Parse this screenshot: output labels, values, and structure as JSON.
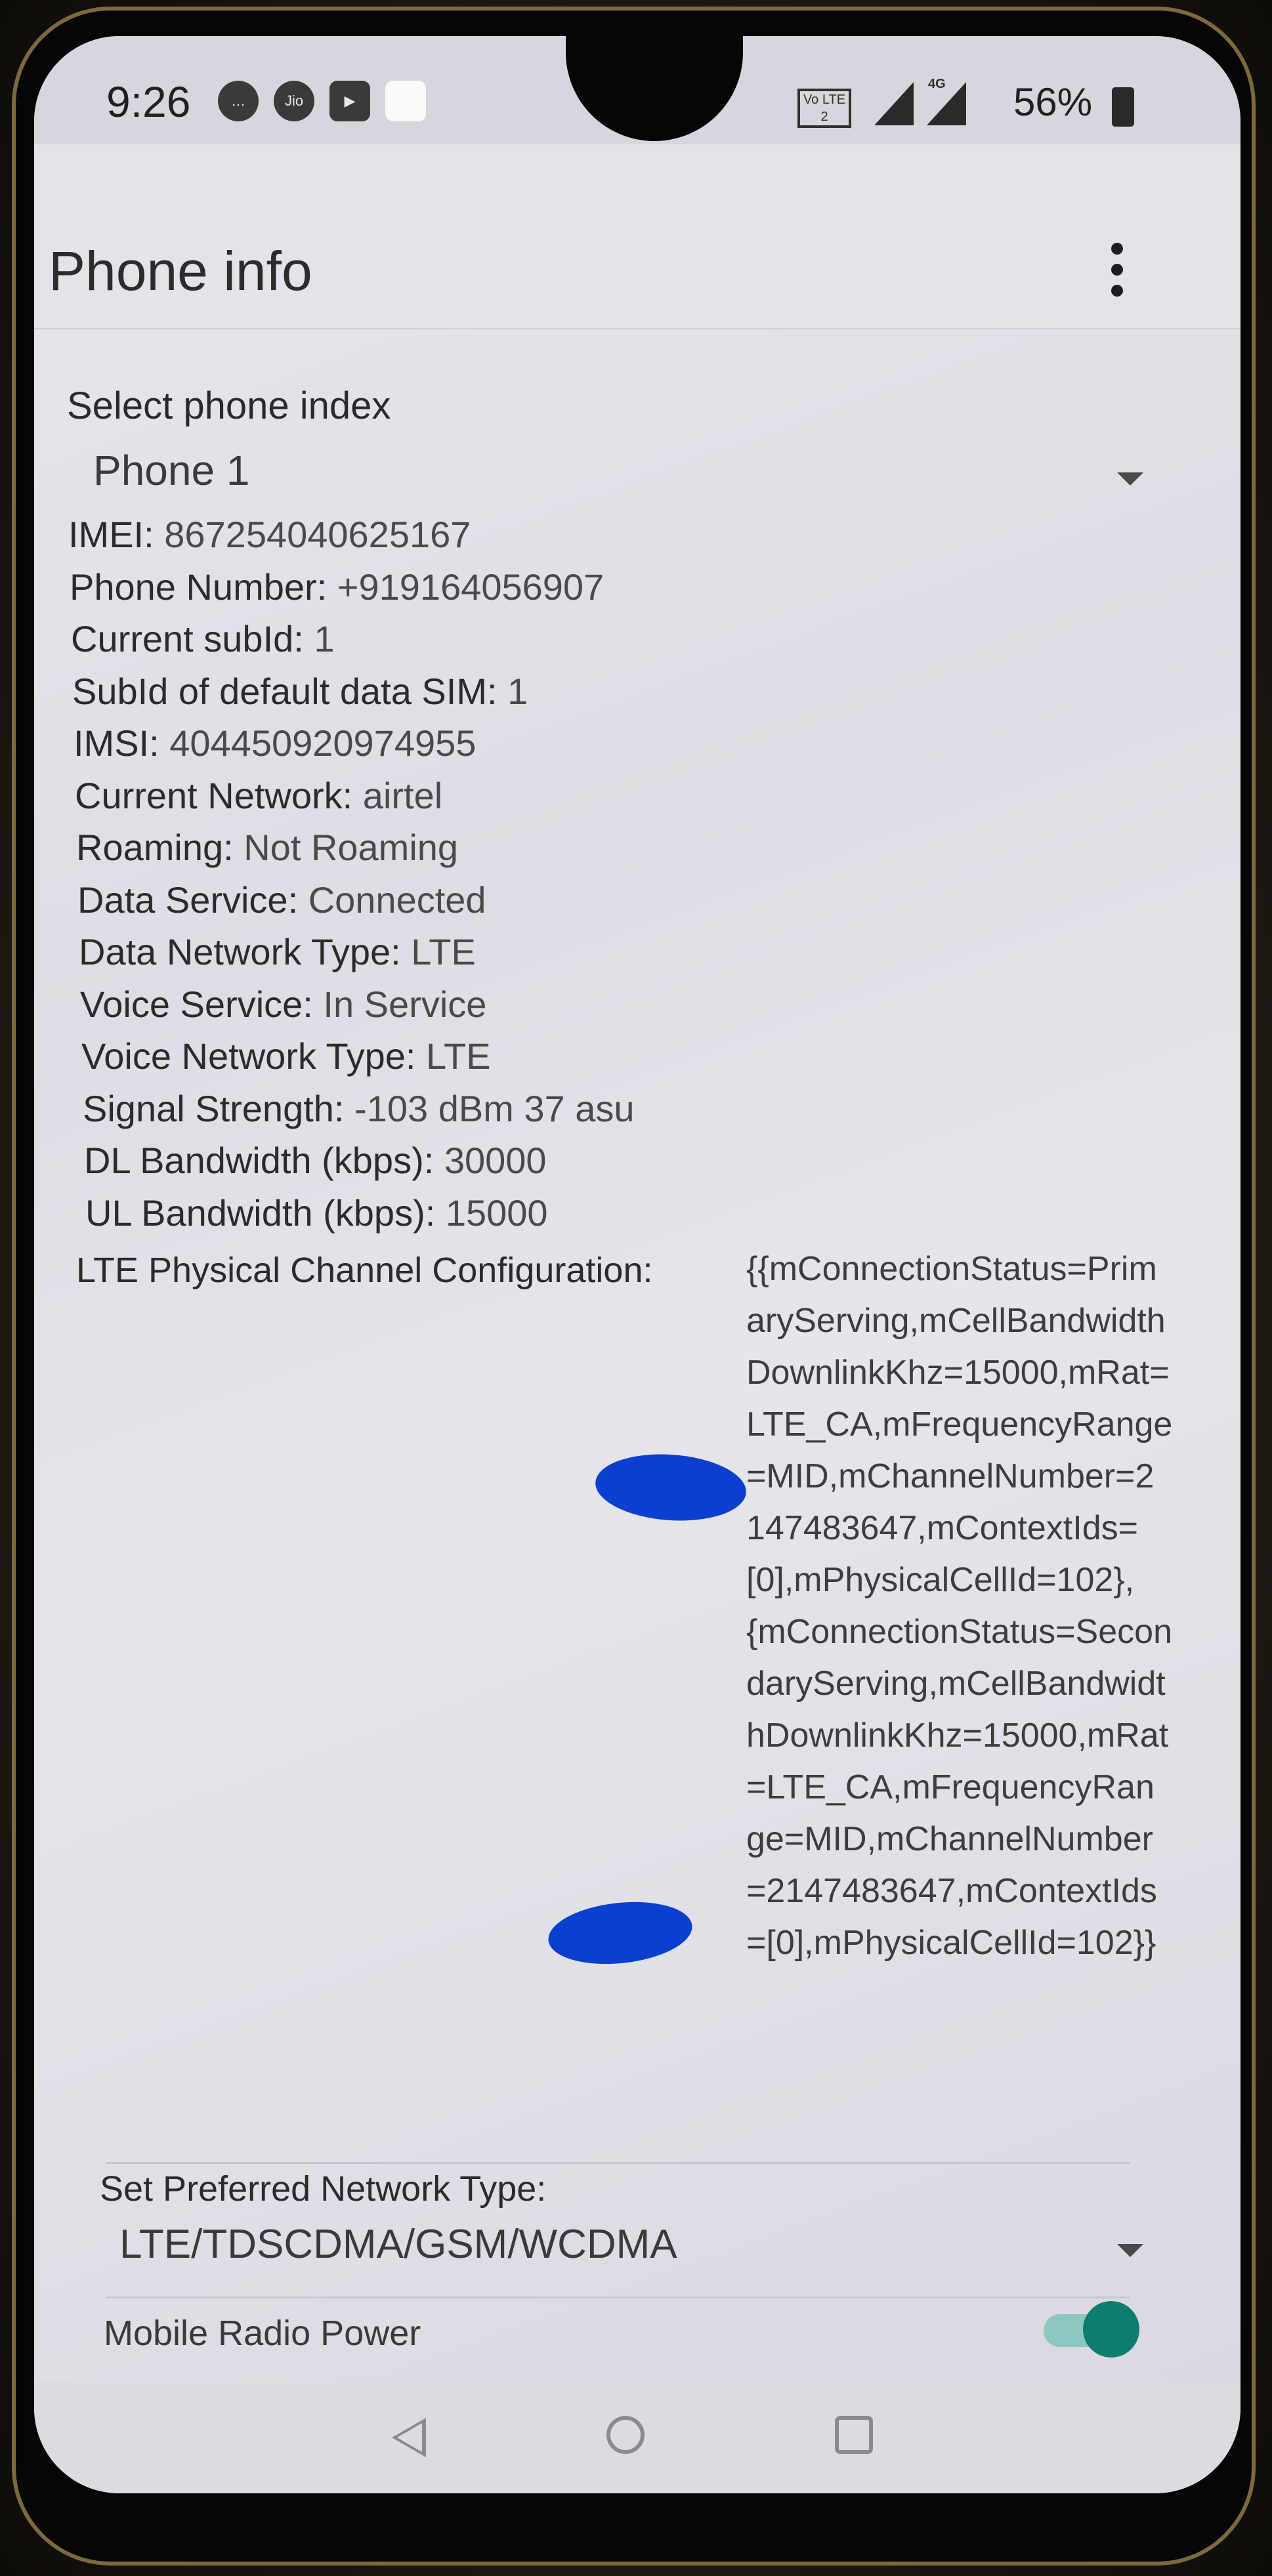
{
  "status_bar": {
    "time": "9:26",
    "volte_label": "Vo LTE 2",
    "network_label": "4G",
    "battery": "56%"
  },
  "app_bar": {
    "title": "Phone info"
  },
  "phone_index": {
    "label": "Select phone index",
    "selected": "Phone 1"
  },
  "info": [
    {
      "key": "IMEI:",
      "value": "867254040625167"
    },
    {
      "key": "Phone Number:",
      "value": "+919164056907"
    },
    {
      "key": "Current subId:",
      "value": "1"
    },
    {
      "key": "SubId of default data SIM:",
      "value": "1"
    },
    {
      "key": "IMSI:",
      "value": "404450920974955"
    },
    {
      "key": "Current Network:",
      "value": "airtel"
    },
    {
      "key": "Roaming:",
      "value": "Not Roaming"
    },
    {
      "key": "Data Service:",
      "value": "Connected"
    },
    {
      "key": "Data Network Type:",
      "value": "LTE"
    },
    {
      "key": "Voice Service:",
      "value": "In Service"
    },
    {
      "key": "Voice Network Type:",
      "value": "LTE"
    },
    {
      "key": "Signal Strength:",
      "value": "-103 dBm   37 asu"
    },
    {
      "key": "DL Bandwidth (kbps):",
      "value": "30000"
    },
    {
      "key": "UL Bandwidth (kbps):",
      "value": "15000"
    }
  ],
  "lte_config": {
    "label": "LTE Physical Channel Configuration:",
    "value": "{{mConnectionStatus=PrimaryServing,mCellBandwidthDownlinkKhz=15000,mRat=LTE_CA,mFrequencyRange=MID,mChannelNumber=2147483647,mContextIds=[0],mPhysicalCellId=102},{mConnectionStatus=SecondaryServing,mCellBandwidthDownlinkKhz=15000,mRat=LTE_CA,mFrequencyRange=MID,mChannelNumber=2147483647,mContextIds=[0],mPhysicalCellId=102}}"
  },
  "preferred_network": {
    "label": "Set Preferred Network Type:",
    "selected": "LTE/TDSCDMA/GSM/WCDMA"
  },
  "mobile_radio_power": {
    "label": "Mobile Radio Power",
    "enabled": true
  },
  "colors": {
    "toggle_thumb": "#0c7d70",
    "toggle_track": "#8cc7c2",
    "redaction": "#0a3fd0"
  }
}
